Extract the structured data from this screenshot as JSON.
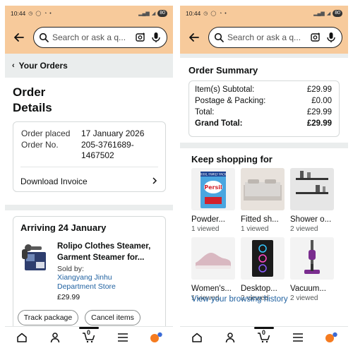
{
  "status_bar": {
    "time": "10:44",
    "battery": "80"
  },
  "search": {
    "placeholder": "Search or ask a q..."
  },
  "breadcrumb": {
    "label": "Your Orders"
  },
  "order_details": {
    "title_line1": "Order",
    "title_line2": "Details",
    "order_placed_label": "Order placed",
    "order_placed_value": "17 January 2026",
    "order_no_label": "Order No.",
    "order_no_value_line1": "205-3761689-",
    "order_no_value_line2": "1467502",
    "download_invoice": "Download Invoice"
  },
  "shipment": {
    "title": "Arriving 24 January",
    "product_name_line1": "Rolipo Clothes Steamer,",
    "product_name_line2": "Garment Steamer for...",
    "sold_by_label": "Sold by:",
    "seller_line1": "Xiangyang Jinhu",
    "seller_line2": "Department Store",
    "price": "£29.99",
    "track_button": "Track package",
    "cancel_button": "Cancel items"
  },
  "order_summary": {
    "title": "Order Summary",
    "rows": [
      {
        "label": "Item(s) Subtotal:",
        "amount": "£29.99"
      },
      {
        "label": "Postage & Packing:",
        "amount": "£0.00"
      },
      {
        "label": "Total:",
        "amount": "£29.99"
      },
      {
        "label": "Grand Total:",
        "amount": "£29.99"
      }
    ]
  },
  "keep_shopping": {
    "title": "Keep shopping for",
    "items": [
      {
        "name": "Powder...",
        "viewed": "1 viewed"
      },
      {
        "name": "Fitted sh...",
        "viewed": "1 viewed"
      },
      {
        "name": "Shower o...",
        "viewed": "2 viewed"
      },
      {
        "name": "Women's...",
        "viewed": "1 viewed"
      },
      {
        "name": "Desktop...",
        "viewed": "2 viewed"
      },
      {
        "name": "Vacuum...",
        "viewed": "2 viewed"
      }
    ],
    "persil_brand": "Persil",
    "persil_banner": "XXXL FAMILY PACK",
    "browsing_history_link": "View your browsing history"
  },
  "bottom_nav": {
    "cart_count": "0"
  },
  "colors": {
    "header": "#f7ca9b",
    "link": "#2162a1",
    "border": "#d5d9d9",
    "page_bg": "#eaeded"
  }
}
